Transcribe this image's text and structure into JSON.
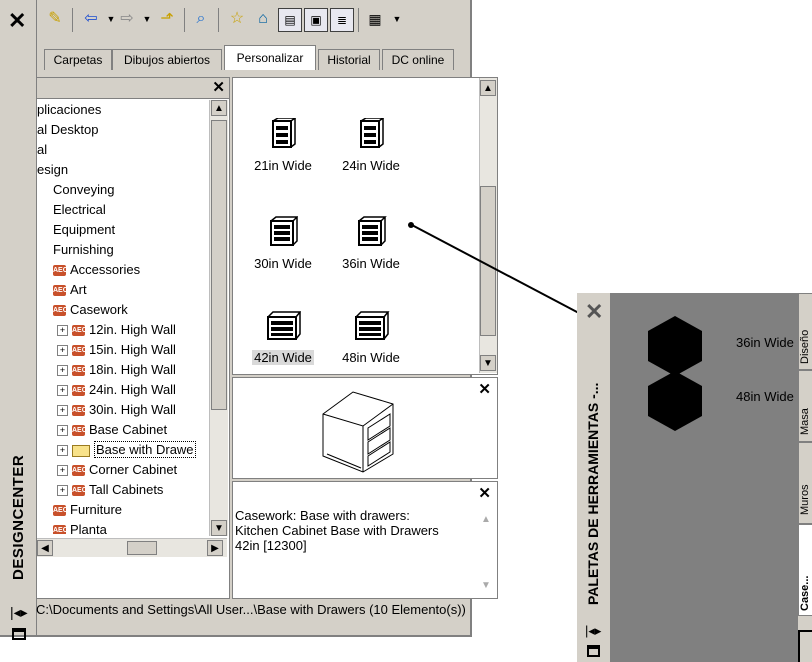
{
  "designcenter": {
    "title": "DESIGNCENTER",
    "tabs": [
      {
        "label": "Carpetas"
      },
      {
        "label": "Dibujos abiertos"
      },
      {
        "label": "Personalizar"
      },
      {
        "label": "Historial"
      },
      {
        "label": "DC online"
      }
    ],
    "tree": {
      "items": [
        {
          "label": "plicaciones"
        },
        {
          "label": "al Desktop"
        },
        {
          "label": "al"
        },
        {
          "label": "esign"
        },
        {
          "label": "Conveying"
        },
        {
          "label": "Electrical"
        },
        {
          "label": "Equipment"
        },
        {
          "label": "Furnishing"
        },
        {
          "label": "Accessories"
        },
        {
          "label": "Art"
        },
        {
          "label": "Casework"
        },
        {
          "label": "12in. High Wall"
        },
        {
          "label": "15in. High Wall"
        },
        {
          "label": "18in. High Wall"
        },
        {
          "label": "24in. High Wall"
        },
        {
          "label": "30in. High Wall"
        },
        {
          "label": "Base Cabinet"
        },
        {
          "label": "Base with Drawe"
        },
        {
          "label": "Corner Cabinet"
        },
        {
          "label": "Tall Cabinets"
        },
        {
          "label": "Furniture"
        },
        {
          "label": "Planta"
        }
      ]
    },
    "content": {
      "items": [
        {
          "label": "21in Wide"
        },
        {
          "label": "24in Wide"
        },
        {
          "label": "30in Wide"
        },
        {
          "label": "36in Wide"
        },
        {
          "label": "42in Wide"
        },
        {
          "label": "48in Wide"
        }
      ]
    },
    "description": "Casework: Base with drawers: Kitchen Cabinet Base with Drawers 42in [12300]",
    "status": "C:\\Documents and Settings\\All User...\\Base with Drawers (10 Elemento(s))"
  },
  "tool_palette": {
    "title": "PALETAS DE HERRAMIENTAS -...",
    "items": [
      {
        "label": "36in Wide"
      },
      {
        "label": "48in Wide"
      }
    ],
    "side_tabs": [
      {
        "label": "Diseño"
      },
      {
        "label": "Masa"
      },
      {
        "label": "Muros"
      },
      {
        "label": "Case..."
      }
    ]
  }
}
